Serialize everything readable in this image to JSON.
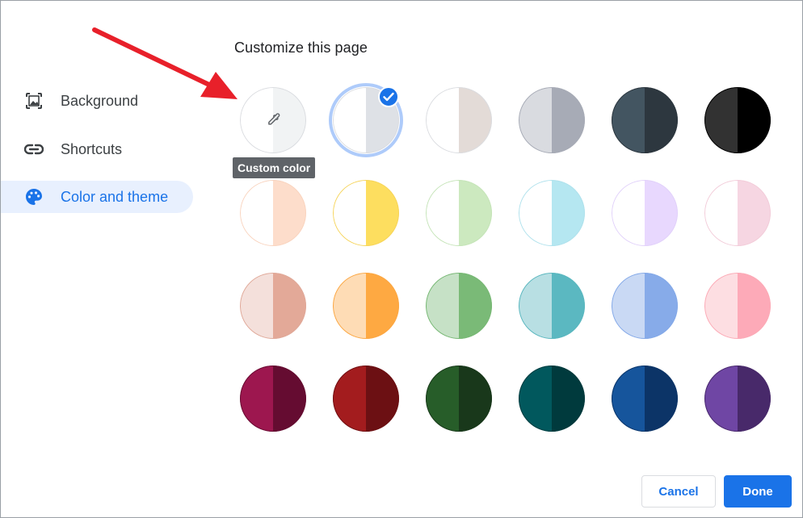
{
  "dialog": {
    "title": "Customize this page"
  },
  "sidebar": {
    "items": [
      {
        "label": "Background",
        "icon": "image-icon",
        "active": false
      },
      {
        "label": "Shortcuts",
        "icon": "link-icon",
        "active": false
      },
      {
        "label": "Color and theme",
        "icon": "palette-icon",
        "active": true
      }
    ]
  },
  "custom_color": {
    "tooltip": "Custom color",
    "icon": "eyedropper-icon"
  },
  "swatches": [
    {
      "name": "default",
      "left": "#ffffff",
      "right": "#dee1e6",
      "border": "#dadce0",
      "selected": true
    },
    {
      "name": "warm-grey",
      "left": "#ffffff",
      "right": "#e3dbd7",
      "border": "#dadce0"
    },
    {
      "name": "cool-grey",
      "left": "#d9dbe0",
      "right": "#a7abb6",
      "border": "#a7abb6"
    },
    {
      "name": "blue-grey",
      "left": "#435561",
      "right": "#2d373f",
      "border": "#2d373f"
    },
    {
      "name": "black",
      "left": "#323232",
      "right": "#000000",
      "border": "#000000"
    },
    {
      "name": "peach-light",
      "left": "#ffffff",
      "right": "#fdddcb",
      "border": "#f9d4bf"
    },
    {
      "name": "yellow",
      "left": "#ffffff",
      "right": "#fdde5f",
      "border": "#f6d45a"
    },
    {
      "name": "green-light",
      "left": "#ffffff",
      "right": "#cce9bf",
      "border": "#c5e4b8"
    },
    {
      "name": "cyan-light",
      "left": "#ffffff",
      "right": "#b5e7f1",
      "border": "#afe1ec"
    },
    {
      "name": "lavender-light",
      "left": "#ffffff",
      "right": "#e8d8fe",
      "border": "#e1d1fa"
    },
    {
      "name": "pink-light",
      "left": "#ffffff",
      "right": "#f6d6e2",
      "border": "#f2ccd9"
    },
    {
      "name": "rose",
      "left": "#f4e0db",
      "right": "#e3a998",
      "border": "#e0a999"
    },
    {
      "name": "apricot",
      "left": "#fedcb5",
      "right": "#fea942",
      "border": "#fba743"
    },
    {
      "name": "green",
      "left": "#c6e1c6",
      "right": "#7aba77",
      "border": "#77b874"
    },
    {
      "name": "teal",
      "left": "#b8dfe3",
      "right": "#5bb8c1",
      "border": "#5ab7bf"
    },
    {
      "name": "periwinkle",
      "left": "#c9d9f4",
      "right": "#87abe9",
      "border": "#84a9e8"
    },
    {
      "name": "pink",
      "left": "#fddee2",
      "right": "#fdaab8",
      "border": "#fcaab6"
    },
    {
      "name": "wine",
      "left": "#9d174f",
      "right": "#650c31",
      "border": "#650c31"
    },
    {
      "name": "red",
      "left": "#a31c1e",
      "right": "#6c1013",
      "border": "#6c1013"
    },
    {
      "name": "dark-green",
      "left": "#275d29",
      "right": "#19381b",
      "border": "#19381b"
    },
    {
      "name": "dark-teal",
      "left": "#01585d",
      "right": "#003a3d",
      "border": "#003a3d"
    },
    {
      "name": "navy",
      "left": "#16559c",
      "right": "#0c3467",
      "border": "#0c3467"
    },
    {
      "name": "violet",
      "left": "#6f46a4",
      "right": "#48296a",
      "border": "#48296a"
    }
  ],
  "footer": {
    "cancel_label": "Cancel",
    "done_label": "Done"
  },
  "colors": {
    "accent": "#1a73e8",
    "annotation_arrow": "#e8202a"
  }
}
